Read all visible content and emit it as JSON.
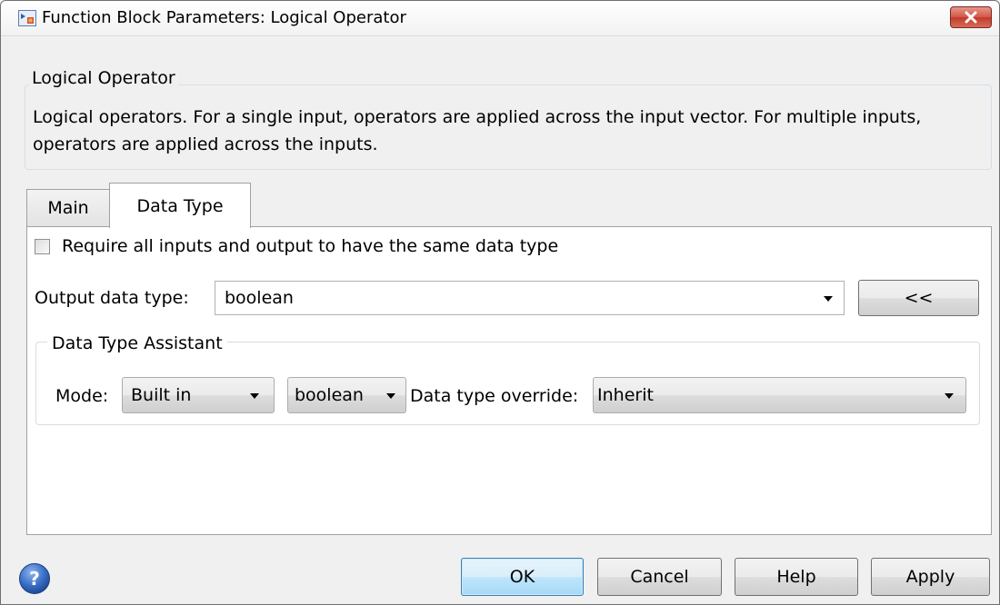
{
  "window": {
    "title": "Function Block Parameters: Logical Operator",
    "icons": [
      "simulink-block-icon",
      "close-icon"
    ]
  },
  "description": {
    "group_title": "Logical Operator",
    "text": "Logical operators.  For a single input, operators are applied across the input vector.  For multiple inputs, operators are applied across the inputs."
  },
  "tabs": [
    {
      "label": "Main",
      "selected": false
    },
    {
      "label": "Data Type",
      "selected": true
    }
  ],
  "data_type_tab": {
    "same_type_checkbox": {
      "label": "Require all inputs and output to have the same data type",
      "checked": false
    },
    "output_data_type": {
      "label": "Output data type:",
      "value": "boolean"
    },
    "collapse_button": "<<",
    "assistant": {
      "title": "Data Type Assistant",
      "mode_label": "Mode:",
      "mode_value": "Built in",
      "type_value": "boolean",
      "override_label": "Data type override:",
      "override_value": "Inherit"
    }
  },
  "buttons": {
    "ok": "OK",
    "cancel": "Cancel",
    "help": "Help",
    "apply": "Apply"
  },
  "colors": {
    "close_button": "#c9473a",
    "help_icon": "#3a70c8",
    "default_button_border": "#3c7fb1"
  }
}
